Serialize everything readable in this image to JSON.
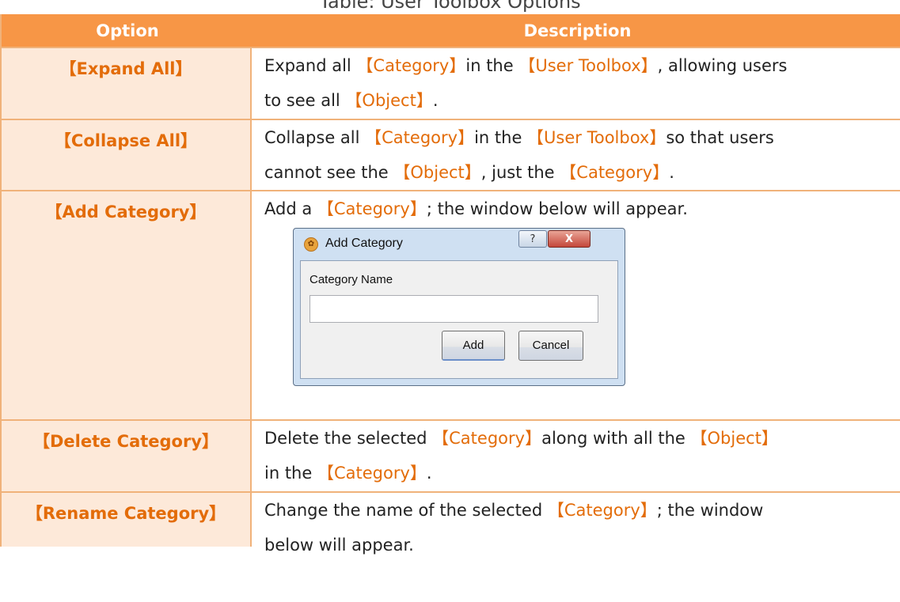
{
  "caption": "Table: User Toolbox Options",
  "table": {
    "header": {
      "option": "Option",
      "description": "Description"
    },
    "rows": [
      {
        "option": "【Expand All】",
        "lines": [
          [
            [
              "Expand all ",
              false
            ],
            [
              "【Category】",
              true
            ],
            [
              "in the ",
              false
            ],
            [
              "【User Toolbox】",
              true
            ],
            [
              ", allowing users",
              false
            ]
          ],
          [
            [
              "to see all ",
              false
            ],
            [
              "【Object】",
              true
            ],
            [
              ".",
              false
            ]
          ]
        ]
      },
      {
        "option": "【Collapse All】",
        "lines": [
          [
            [
              "Collapse all ",
              false
            ],
            [
              "【Category】",
              true
            ],
            [
              "in the ",
              false
            ],
            [
              "【User Toolbox】",
              true
            ],
            [
              "so that users",
              false
            ]
          ],
          [
            [
              "cannot see the ",
              false
            ],
            [
              "【Object】",
              true
            ],
            [
              ", just the ",
              false
            ],
            [
              "【Category】",
              true
            ],
            [
              ".",
              false
            ]
          ]
        ]
      },
      {
        "option": "【Add Category】",
        "lines": [
          [
            [
              "Add a ",
              false
            ],
            [
              "【Category】",
              true
            ],
            [
              "; the window below will appear.",
              false
            ]
          ]
        ]
      },
      {
        "option": "【Delete Category】",
        "lines": [
          [
            [
              "Delete the selected ",
              false
            ],
            [
              "【Category】",
              true
            ],
            [
              "along with all the ",
              false
            ],
            [
              "【Object】",
              true
            ]
          ],
          [
            [
              "in the ",
              false
            ],
            [
              "【Category】",
              true
            ],
            [
              ".",
              false
            ]
          ]
        ]
      },
      {
        "option": "【Rename Category】",
        "lines": [
          [
            [
              "Change the name of the selected ",
              false
            ],
            [
              "【Category】",
              true
            ],
            [
              "; the window",
              false
            ]
          ],
          [
            [
              "below will appear.",
              false
            ]
          ]
        ]
      }
    ]
  },
  "dialog": {
    "title": "Add Category",
    "help_label": "?",
    "close_label": "X",
    "field_label": "Category Name",
    "field_value": "",
    "add_label": "Add",
    "cancel_label": "Cancel"
  },
  "colors": {
    "header_bg": "#f79646",
    "option_bg": "#fde9d9",
    "keyword": "#e36c09",
    "border": "#f0b27a"
  }
}
